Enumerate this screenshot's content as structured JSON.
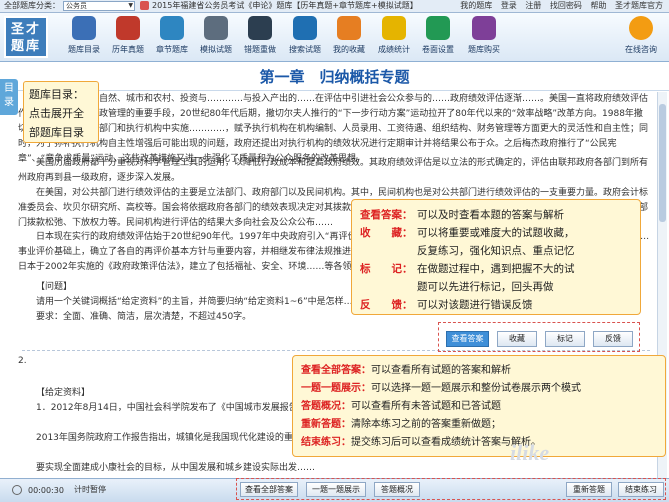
{
  "topbar": {
    "category_label": "全部题库分类：",
    "category_selected": "公务员",
    "package_text": "2015年福建省公务员考试《申论》题库【历年真题+章节题库+模拟试题】",
    "links": [
      "我的题库",
      "登录",
      "注册",
      "找回密码",
      "帮助",
      "圣才题库官方"
    ]
  },
  "logo": {
    "line1": "圣才",
    "line2": "题库"
  },
  "toolbar": {
    "items": [
      {
        "label": "题库目录",
        "icon": "catalog-icon",
        "color": "#3b6fb6"
      },
      {
        "label": "历年真题",
        "icon": "exam-paper-icon",
        "color": "#c0392b"
      },
      {
        "label": "章节题库",
        "icon": "chapter-book-icon",
        "color": "#2e86c1"
      },
      {
        "label": "模拟试题",
        "icon": "mock-test-icon",
        "color": "#5d6d7e"
      },
      {
        "label": "错题重做",
        "icon": "redo-icon",
        "color": "#2c3e50"
      },
      {
        "label": "搜索试题",
        "icon": "search-icon",
        "color": "#1f6fb2"
      },
      {
        "label": "我的收藏",
        "icon": "favorite-icon",
        "color": "#e67e22"
      },
      {
        "label": "成绩统计",
        "icon": "statistics-icon",
        "color": "#e5b400"
      },
      {
        "label": "卷面设置",
        "icon": "settings-icon",
        "color": "#229954"
      },
      {
        "label": "题库购买",
        "icon": "cart-icon",
        "color": "#7e3f98"
      }
    ],
    "online": {
      "label": "在线咨询",
      "icon": "chat-icon",
      "color": "#f39c12"
    }
  },
  "page_title": "第一章　归纳概括专题",
  "left_tab": "目录",
  "content": {
    "paragraphs": [
      "……社会、人与自然、城市和农村、投资与…………与投入产出的……在评估中引进社会公众参与的……政府绩效评估逐渐……。美国一直将政府绩效评估作为其行政改革与财政管理的重要手段，20世纪80年代后期，撒切尔夫人推行的“下一步行动方案”运动拉开了80年代以来的“效率战略”改革方向。1988年撒切尔政府明确提出在部门和执行机构中实施…………，赋予执行机构在机构编制、人员录用、工资待遇、组织结构、财务管理等方面更大的灵活性和自主性；同时，为了弥补执行机构自主性增强后可能出现的问题，政府还提出对执行机构的绩效状况进行定期审计并将结果公布于众。之后梅杰政府推行了“公民宪章”、“竞争求质量”运动，这些改革措施又进一步强化了质量和为公众服务的改革思想。",
      "美国历届政府都十分重视对科学管理工具的运用，以降低行政成本和提高政府绩效。其政府绩效评估是以立法的形式确定的，评估由联邦政府各部门到所有州政府再到县一级政府，逐步深入发展。",
      "在美国，对公共部门进行绩效评估的主要是立法部门、政府部门以及民间机构。其中，民间机构也是对公共部门进行绩效评估的一支重要力量。政府会计标准委员会、坎贝尔研究所、高校等。国会将依据政府各部门的绩效表现决定对其拨款的多少，这就迫使…………绩效评估，并将评估结果报送国会。绩效对该部门拨款松弛、下放权力等。民间机构进行评估的结果大多向社会及公众公布……",
      "日本现在实行的政府绩效评估始于20世纪90年代。1997年中央政府引入“再评价”……行评估。此后，各级政府陆续开展政府绩效评估，逐步推进政府……事业评价基础上，确立了各自的再评价基本方针与重要内容，并相继发布律法规推进评估工作。2001年日本政府……推行了政策评价制度，……为减少损失，日本于2002年实施的《政府政策评估法》，建立了包括福祉、安全、环境……等各领域的评估体系，……强化了事前评估制度。"
    ],
    "question_label": "【问题】",
    "question_text": "请用一个关键词概括“给定资料”的主旨，并简要归纳“给定资料1~6”中是怎样……",
    "requirement": "要求：全面、准确、简洁，层次清楚，不超过450字。",
    "q2_number": "2.",
    "q2_material_label": "【给定资料】",
    "q2_paragraphs": [
      "1．2012年8月14日，中国社会科学院发布了《中国城市发展报告》……城镇化率达到51.27%，城镇常住人口超过了农村常住人口，这表明中国……",
      "2013年国务院政府工作报告指出，城镇化是我国现代化建设的重大……",
      "要实现全面建成小康社会的目标，从中国发展和城乡建设实际出发……"
    ]
  },
  "question_buttons": [
    "查看答案",
    "收藏",
    "标记",
    "反馈"
  ],
  "bottom": {
    "timer": "00:00:30",
    "pause": "计时暂停",
    "buttons": [
      "查看全部答案",
      "一题一题展示",
      "答题概况",
      "重新答题",
      "结束练习"
    ]
  },
  "callouts": {
    "catalog": [
      "题库目录：",
      "点击展开全",
      "部题库目录"
    ],
    "question_tools": [
      {
        "key": "查看答案：",
        "text": "可以及时查看本题的答案与解析"
      },
      {
        "key": "收　　藏：",
        "text": "可以将重要或难度大的试题收藏，"
      },
      {
        "key": "",
        "text": "反复练习，强化知识点、重点记忆"
      },
      {
        "key": "标　　记：",
        "text": "在做题过程中，遇到把握不大的试"
      },
      {
        "key": "",
        "text": "题可以先进行标记，回头再做"
      },
      {
        "key": "反　　馈：",
        "text": "可以对该题进行错误反馈"
      }
    ],
    "global_tools": [
      {
        "key": "查看全部答案：",
        "text": "可以查看所有试题的答案和解析"
      },
      {
        "key": "一题一题展示：",
        "text": "可以选择一题一题展示和整份试卷展示两个模式"
      },
      {
        "key": "答题概况：",
        "text": "可以查看所有未答试题和已答试题"
      },
      {
        "key": "重新答题：",
        "text": "清除本练习之前的答案重新做题；"
      },
      {
        "key": "结束练习：",
        "text": "提交练习后可以查看成绩统计答案与解析。"
      }
    ]
  },
  "watermark": "ilike"
}
